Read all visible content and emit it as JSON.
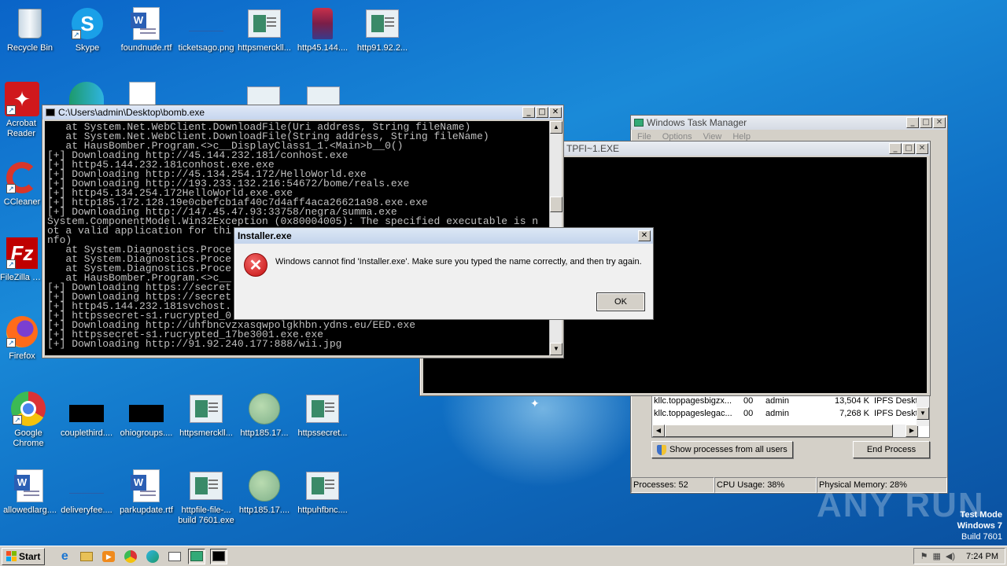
{
  "desktop": {
    "icons": [
      {
        "label": "Recycle Bin",
        "icon": "recycle-bin-icon"
      },
      {
        "label": "Skype",
        "icon": "skype-icon"
      },
      {
        "label": "foundnude.rtf",
        "icon": "rtf-document-icon"
      },
      {
        "label": "ticketsago.png",
        "icon": "blank-file-icon"
      },
      {
        "label": "httpsmerckll...",
        "icon": "image-file-icon"
      },
      {
        "label": "http45.144....",
        "icon": "image-file-icon"
      },
      {
        "label": "http91.92.2...",
        "icon": "image-file-icon"
      },
      {
        "label": "Acrobat Reader DC",
        "icon": "acrobat-icon"
      },
      {
        "label": "CCleaner",
        "icon": "ccleaner-icon"
      },
      {
        "label": "FileZilla Cl...",
        "icon": "filezilla-icon"
      },
      {
        "label": "Firefox",
        "icon": "firefox-icon"
      },
      {
        "label": "Google Chrome",
        "icon": "chrome-icon"
      },
      {
        "label": "couplethird....",
        "icon": "black-file-icon"
      },
      {
        "label": "ohiogroups....",
        "icon": "black-file-icon"
      },
      {
        "label": "httpsmerckll...",
        "icon": "image-file-icon"
      },
      {
        "label": "http185.17...",
        "icon": "ball-file-icon"
      },
      {
        "label": "httpssecret...",
        "icon": "image-file-icon"
      },
      {
        "label": "allowedlarg....",
        "icon": "rtf-document-icon"
      },
      {
        "label": "deliveryfee....",
        "icon": "blank-file-icon"
      },
      {
        "label": "parkupdate.rtf",
        "icon": "rtf-document-icon"
      },
      {
        "label": "httpfile-file-...",
        "icon": "image-file-icon"
      },
      {
        "label": "http185.17....",
        "icon": "ball-file-icon"
      },
      {
        "label": "httpuhfbnc....",
        "icon": "image-file-icon"
      }
    ],
    "under_label": "build 7601.exe"
  },
  "console": {
    "title": "C:\\Users\\admin\\Desktop\\bomb.exe",
    "lines": [
      "   at System.Net.WebClient.DownloadFile(Uri address, String fileName)",
      "   at System.Net.WebClient.DownloadFile(String address, String fileName)",
      "   at HausBomber.Program.<>c__DisplayClass1_1.<Main>b__0()",
      "[+] Downloading http://45.144.232.181/conhost.exe",
      "[+] http45.144.232.181conhost.exe.exe",
      "[+] Downloading http://45.134.254.172/HelloWorld.exe",
      "[+] Downloading http://193.233.132.216:54672/bome/reals.exe",
      "[+] http45.134.254.172HelloWorld.exe.exe",
      "[+] http185.172.128.19e0cbefcb1af40c7d4aff4aca26621a98.exe.exe",
      "[+] Downloading http://147.45.47.93:33758/negra/summa.exe",
      "System.ComponentModel.Win32Exception (0x80004005): The specified executable is n",
      "ot a valid application for thi",
      "nfo)",
      "   at System.Diagnostics.Proce",
      "   at System.Diagnostics.Proce",
      "   at HausBomber.Program.<>c__",
      "[+] Downloading https://secret",
      "[+] Downloading https://secret",
      "[+] http45.144.232.181svchost.",
      "[+] httpssecret-s1.rucrypted_0",
      "[+] Downloading http://uhfbncvzxasqwpolgkhbn.ydns.eu/EED.exe",
      "[+] httpssecret-s1.rucrypted_17be3001.exe.exe",
      "[+] Downloading http://91.92.240.177:888/wii.jpg"
    ],
    "partial_line": "   at System.Diagnostics.Proce"
  },
  "second_console": {
    "title": "TPFI~1.EXE"
  },
  "task_manager": {
    "title": "Windows Task Manager",
    "menu": [
      "File",
      "Options",
      "View",
      "Help"
    ],
    "rows": [
      {
        "name": "kllc.toppagesbigzx...",
        "cpu": "00",
        "user": "admin",
        "mem": "13,504 K",
        "desc": "IPFS Deskto"
      },
      {
        "name": "kllc.toppageslegac...",
        "cpu": "00",
        "user": "admin",
        "mem": "7,268 K",
        "desc": "IPFS Deskto"
      }
    ],
    "show_all_label": "Show processes from all users",
    "end_process_label": "End Process",
    "status": {
      "processes": "Processes: 52",
      "cpu": "CPU Usage: 38%",
      "memory": "Physical Memory: 28%"
    }
  },
  "dialog": {
    "title": "Installer.exe",
    "message": "Windows cannot find 'Installer.exe'. Make sure you typed the name correctly, and then try again.",
    "ok_label": "OK"
  },
  "watermark": {
    "text": "ANY RUN",
    "test_mode": "Test Mode",
    "os": "Windows 7",
    "build": "Build 7601"
  },
  "taskbar": {
    "start_label": "Start",
    "clock": "7:24 PM"
  }
}
